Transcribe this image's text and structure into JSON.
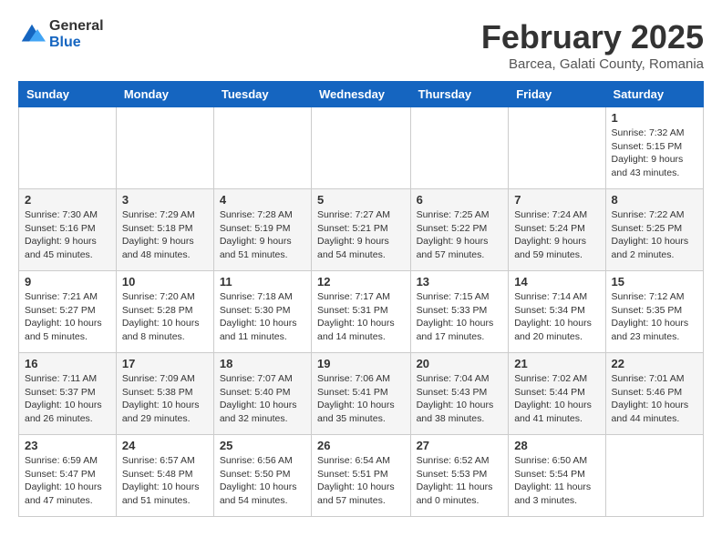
{
  "header": {
    "logo": {
      "general": "General",
      "blue": "Blue"
    },
    "month": "February 2025",
    "location": "Barcea, Galati County, Romania"
  },
  "days_of_week": [
    "Sunday",
    "Monday",
    "Tuesday",
    "Wednesday",
    "Thursday",
    "Friday",
    "Saturday"
  ],
  "weeks": [
    [
      {
        "day": "",
        "info": ""
      },
      {
        "day": "",
        "info": ""
      },
      {
        "day": "",
        "info": ""
      },
      {
        "day": "",
        "info": ""
      },
      {
        "day": "",
        "info": ""
      },
      {
        "day": "",
        "info": ""
      },
      {
        "day": "1",
        "info": "Sunrise: 7:32 AM\nSunset: 5:15 PM\nDaylight: 9 hours and 43 minutes."
      }
    ],
    [
      {
        "day": "2",
        "info": "Sunrise: 7:30 AM\nSunset: 5:16 PM\nDaylight: 9 hours and 45 minutes."
      },
      {
        "day": "3",
        "info": "Sunrise: 7:29 AM\nSunset: 5:18 PM\nDaylight: 9 hours and 48 minutes."
      },
      {
        "day": "4",
        "info": "Sunrise: 7:28 AM\nSunset: 5:19 PM\nDaylight: 9 hours and 51 minutes."
      },
      {
        "day": "5",
        "info": "Sunrise: 7:27 AM\nSunset: 5:21 PM\nDaylight: 9 hours and 54 minutes."
      },
      {
        "day": "6",
        "info": "Sunrise: 7:25 AM\nSunset: 5:22 PM\nDaylight: 9 hours and 57 minutes."
      },
      {
        "day": "7",
        "info": "Sunrise: 7:24 AM\nSunset: 5:24 PM\nDaylight: 9 hours and 59 minutes."
      },
      {
        "day": "8",
        "info": "Sunrise: 7:22 AM\nSunset: 5:25 PM\nDaylight: 10 hours and 2 minutes."
      }
    ],
    [
      {
        "day": "9",
        "info": "Sunrise: 7:21 AM\nSunset: 5:27 PM\nDaylight: 10 hours and 5 minutes."
      },
      {
        "day": "10",
        "info": "Sunrise: 7:20 AM\nSunset: 5:28 PM\nDaylight: 10 hours and 8 minutes."
      },
      {
        "day": "11",
        "info": "Sunrise: 7:18 AM\nSunset: 5:30 PM\nDaylight: 10 hours and 11 minutes."
      },
      {
        "day": "12",
        "info": "Sunrise: 7:17 AM\nSunset: 5:31 PM\nDaylight: 10 hours and 14 minutes."
      },
      {
        "day": "13",
        "info": "Sunrise: 7:15 AM\nSunset: 5:33 PM\nDaylight: 10 hours and 17 minutes."
      },
      {
        "day": "14",
        "info": "Sunrise: 7:14 AM\nSunset: 5:34 PM\nDaylight: 10 hours and 20 minutes."
      },
      {
        "day": "15",
        "info": "Sunrise: 7:12 AM\nSunset: 5:35 PM\nDaylight: 10 hours and 23 minutes."
      }
    ],
    [
      {
        "day": "16",
        "info": "Sunrise: 7:11 AM\nSunset: 5:37 PM\nDaylight: 10 hours and 26 minutes."
      },
      {
        "day": "17",
        "info": "Sunrise: 7:09 AM\nSunset: 5:38 PM\nDaylight: 10 hours and 29 minutes."
      },
      {
        "day": "18",
        "info": "Sunrise: 7:07 AM\nSunset: 5:40 PM\nDaylight: 10 hours and 32 minutes."
      },
      {
        "day": "19",
        "info": "Sunrise: 7:06 AM\nSunset: 5:41 PM\nDaylight: 10 hours and 35 minutes."
      },
      {
        "day": "20",
        "info": "Sunrise: 7:04 AM\nSunset: 5:43 PM\nDaylight: 10 hours and 38 minutes."
      },
      {
        "day": "21",
        "info": "Sunrise: 7:02 AM\nSunset: 5:44 PM\nDaylight: 10 hours and 41 minutes."
      },
      {
        "day": "22",
        "info": "Sunrise: 7:01 AM\nSunset: 5:46 PM\nDaylight: 10 hours and 44 minutes."
      }
    ],
    [
      {
        "day": "23",
        "info": "Sunrise: 6:59 AM\nSunset: 5:47 PM\nDaylight: 10 hours and 47 minutes."
      },
      {
        "day": "24",
        "info": "Sunrise: 6:57 AM\nSunset: 5:48 PM\nDaylight: 10 hours and 51 minutes."
      },
      {
        "day": "25",
        "info": "Sunrise: 6:56 AM\nSunset: 5:50 PM\nDaylight: 10 hours and 54 minutes."
      },
      {
        "day": "26",
        "info": "Sunrise: 6:54 AM\nSunset: 5:51 PM\nDaylight: 10 hours and 57 minutes."
      },
      {
        "day": "27",
        "info": "Sunrise: 6:52 AM\nSunset: 5:53 PM\nDaylight: 11 hours and 0 minutes."
      },
      {
        "day": "28",
        "info": "Sunrise: 6:50 AM\nSunset: 5:54 PM\nDaylight: 11 hours and 3 minutes."
      },
      {
        "day": "",
        "info": ""
      }
    ]
  ]
}
